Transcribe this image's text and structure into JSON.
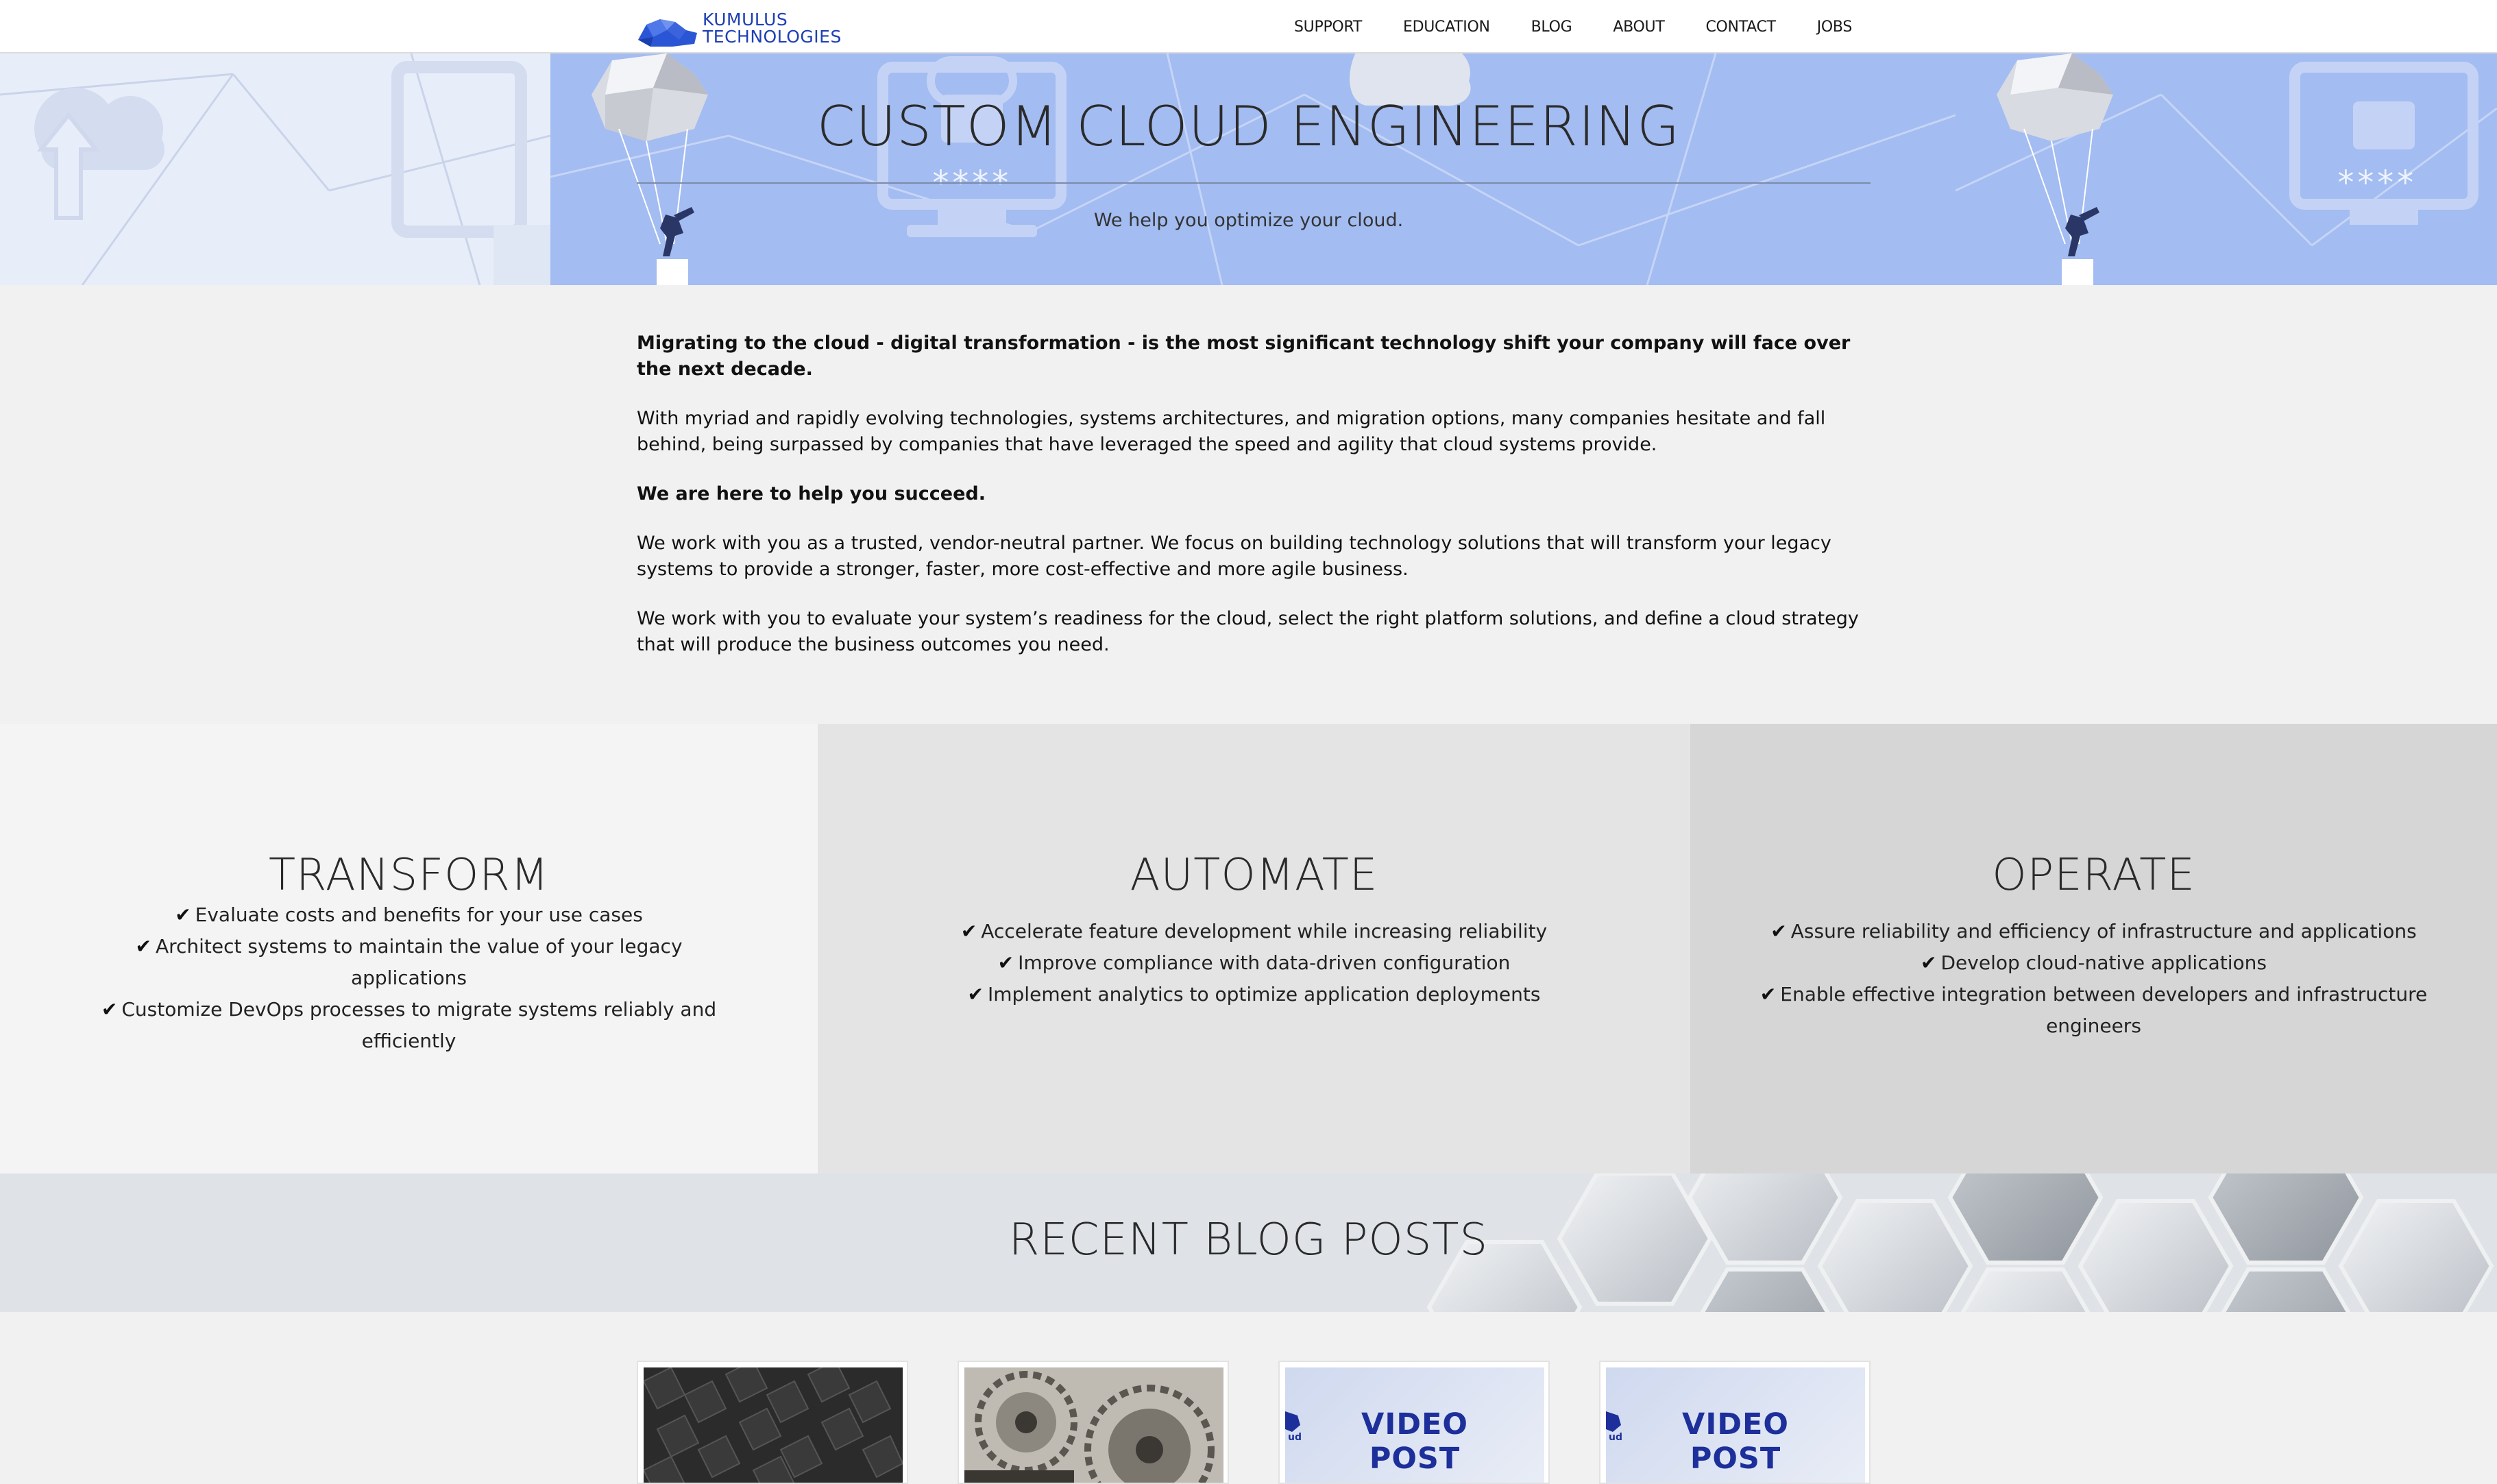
{
  "nav": {
    "logo_line1": "KUMULUS",
    "logo_line2": "TECHNOLOGIES",
    "items": [
      "SUPPORT",
      "EDUCATION",
      "BLOG",
      "ABOUT",
      "CONTACT",
      "JOBS"
    ]
  },
  "hero": {
    "title": "CUSTOM CLOUD ENGINEERING",
    "subtitle": "We help you optimize your cloud.",
    "password_mask": "****"
  },
  "intro": {
    "p1": "Migrating to the cloud - digital transformation - is the most significant technology shift your company will face over the next decade.",
    "p2": "With myriad and rapidly evolving technologies, systems architectures, and migration options, many companies hesitate and fall behind, being surpassed by companies that have leveraged the speed and agility that cloud systems provide.",
    "p3": "We are here to help you succeed.",
    "p4": "We work with you as a trusted, vendor-neutral partner. We focus on building technology solutions that will transform your legacy systems to provide a stronger, faster, more cost-effective and more agile business.",
    "p5": "We work with you to evaluate your system’s readiness for the cloud, select the right platform solutions, and define a cloud strategy that will produce the business outcomes you need."
  },
  "services": [
    {
      "title": "TRANSFORM",
      "items": [
        "Evaluate costs and benefits for your use cases",
        "Architect systems to maintain the value of your legacy applications",
        "Customize DevOps processes to migrate systems reliably and efficiently"
      ]
    },
    {
      "title": "AUTOMATE",
      "items": [
        "Accelerate feature development while increasing reliability",
        "Improve compliance with data-driven configuration",
        "Implement analytics to optimize application deployments"
      ]
    },
    {
      "title": "OPERATE",
      "items": [
        "Assure reliability and efficiency of infrastructure and applications",
        "Develop cloud-native applications",
        "Enable effective integration between developers and infrastructure engineers"
      ]
    }
  ],
  "blog": {
    "title": "RECENT BLOG POSTS",
    "video_line1": "VIDEO",
    "video_line2": "POST",
    "cloud_fragment": "ud"
  },
  "colors": {
    "brand_blue": "#1e3fb4",
    "hero_blue": "#9fb8f0",
    "video_text": "#1d2f9a"
  }
}
